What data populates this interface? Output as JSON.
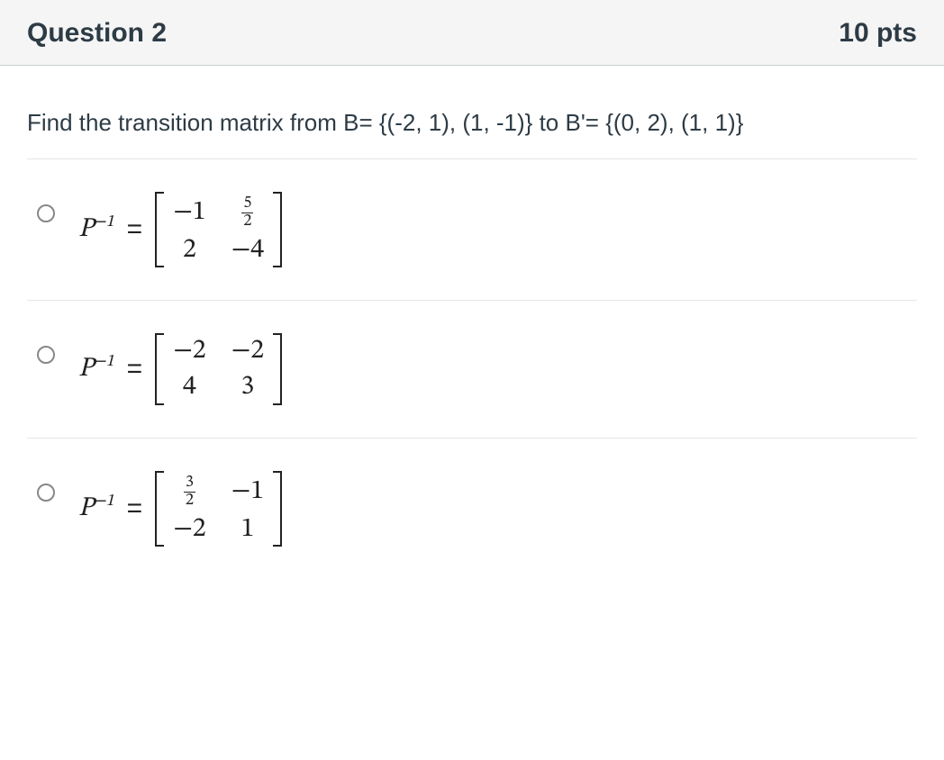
{
  "header": {
    "title": "Question 2",
    "points": "10 pts"
  },
  "prompt": "Find the transition matrix from B= {(-2, 1), (1, -1)} to B'= {(0, 2), (1, 1)}",
  "lhs_html": "P<sup>−1</sup>",
  "eq": "=",
  "options": [
    {
      "cells": [
        {
          "text": "−1"
        },
        {
          "frac": {
            "num": "5",
            "den": "2"
          }
        },
        {
          "text": "2"
        },
        {
          "text": "−4"
        }
      ]
    },
    {
      "cells": [
        {
          "text": "−2"
        },
        {
          "text": "−2"
        },
        {
          "text": "4"
        },
        {
          "text": "3"
        }
      ]
    },
    {
      "cells": [
        {
          "frac": {
            "num": "3",
            "den": "2"
          }
        },
        {
          "text": "−1"
        },
        {
          "text": "−2"
        },
        {
          "text": "1"
        }
      ]
    }
  ]
}
